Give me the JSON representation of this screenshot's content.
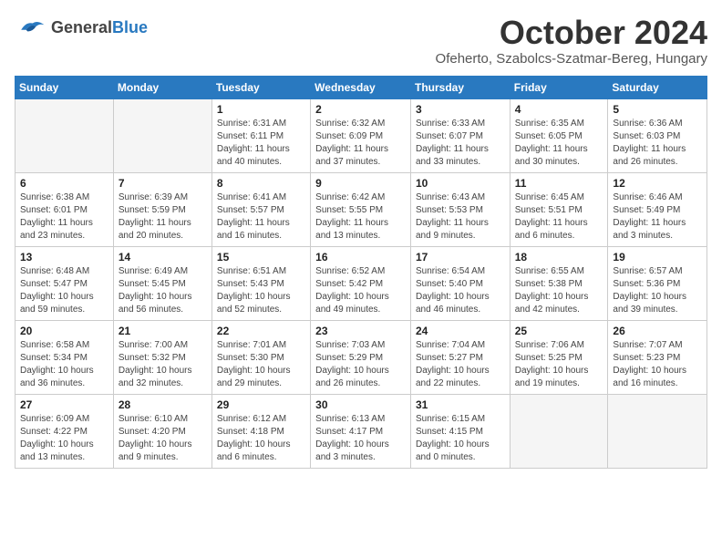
{
  "logo": {
    "line1": "General",
    "line2": "Blue"
  },
  "title": "October 2024",
  "location": "Ofeherto, Szabolcs-Szatmar-Bereg, Hungary",
  "weekdays": [
    "Sunday",
    "Monday",
    "Tuesday",
    "Wednesday",
    "Thursday",
    "Friday",
    "Saturday"
  ],
  "weeks": [
    [
      {
        "day": "",
        "detail": ""
      },
      {
        "day": "",
        "detail": ""
      },
      {
        "day": "1",
        "detail": "Sunrise: 6:31 AM\nSunset: 6:11 PM\nDaylight: 11 hours and 40 minutes."
      },
      {
        "day": "2",
        "detail": "Sunrise: 6:32 AM\nSunset: 6:09 PM\nDaylight: 11 hours and 37 minutes."
      },
      {
        "day": "3",
        "detail": "Sunrise: 6:33 AM\nSunset: 6:07 PM\nDaylight: 11 hours and 33 minutes."
      },
      {
        "day": "4",
        "detail": "Sunrise: 6:35 AM\nSunset: 6:05 PM\nDaylight: 11 hours and 30 minutes."
      },
      {
        "day": "5",
        "detail": "Sunrise: 6:36 AM\nSunset: 6:03 PM\nDaylight: 11 hours and 26 minutes."
      }
    ],
    [
      {
        "day": "6",
        "detail": "Sunrise: 6:38 AM\nSunset: 6:01 PM\nDaylight: 11 hours and 23 minutes."
      },
      {
        "day": "7",
        "detail": "Sunrise: 6:39 AM\nSunset: 5:59 PM\nDaylight: 11 hours and 20 minutes."
      },
      {
        "day": "8",
        "detail": "Sunrise: 6:41 AM\nSunset: 5:57 PM\nDaylight: 11 hours and 16 minutes."
      },
      {
        "day": "9",
        "detail": "Sunrise: 6:42 AM\nSunset: 5:55 PM\nDaylight: 11 hours and 13 minutes."
      },
      {
        "day": "10",
        "detail": "Sunrise: 6:43 AM\nSunset: 5:53 PM\nDaylight: 11 hours and 9 minutes."
      },
      {
        "day": "11",
        "detail": "Sunrise: 6:45 AM\nSunset: 5:51 PM\nDaylight: 11 hours and 6 minutes."
      },
      {
        "day": "12",
        "detail": "Sunrise: 6:46 AM\nSunset: 5:49 PM\nDaylight: 11 hours and 3 minutes."
      }
    ],
    [
      {
        "day": "13",
        "detail": "Sunrise: 6:48 AM\nSunset: 5:47 PM\nDaylight: 10 hours and 59 minutes."
      },
      {
        "day": "14",
        "detail": "Sunrise: 6:49 AM\nSunset: 5:45 PM\nDaylight: 10 hours and 56 minutes."
      },
      {
        "day": "15",
        "detail": "Sunrise: 6:51 AM\nSunset: 5:43 PM\nDaylight: 10 hours and 52 minutes."
      },
      {
        "day": "16",
        "detail": "Sunrise: 6:52 AM\nSunset: 5:42 PM\nDaylight: 10 hours and 49 minutes."
      },
      {
        "day": "17",
        "detail": "Sunrise: 6:54 AM\nSunset: 5:40 PM\nDaylight: 10 hours and 46 minutes."
      },
      {
        "day": "18",
        "detail": "Sunrise: 6:55 AM\nSunset: 5:38 PM\nDaylight: 10 hours and 42 minutes."
      },
      {
        "day": "19",
        "detail": "Sunrise: 6:57 AM\nSunset: 5:36 PM\nDaylight: 10 hours and 39 minutes."
      }
    ],
    [
      {
        "day": "20",
        "detail": "Sunrise: 6:58 AM\nSunset: 5:34 PM\nDaylight: 10 hours and 36 minutes."
      },
      {
        "day": "21",
        "detail": "Sunrise: 7:00 AM\nSunset: 5:32 PM\nDaylight: 10 hours and 32 minutes."
      },
      {
        "day": "22",
        "detail": "Sunrise: 7:01 AM\nSunset: 5:30 PM\nDaylight: 10 hours and 29 minutes."
      },
      {
        "day": "23",
        "detail": "Sunrise: 7:03 AM\nSunset: 5:29 PM\nDaylight: 10 hours and 26 minutes."
      },
      {
        "day": "24",
        "detail": "Sunrise: 7:04 AM\nSunset: 5:27 PM\nDaylight: 10 hours and 22 minutes."
      },
      {
        "day": "25",
        "detail": "Sunrise: 7:06 AM\nSunset: 5:25 PM\nDaylight: 10 hours and 19 minutes."
      },
      {
        "day": "26",
        "detail": "Sunrise: 7:07 AM\nSunset: 5:23 PM\nDaylight: 10 hours and 16 minutes."
      }
    ],
    [
      {
        "day": "27",
        "detail": "Sunrise: 6:09 AM\nSunset: 4:22 PM\nDaylight: 10 hours and 13 minutes."
      },
      {
        "day": "28",
        "detail": "Sunrise: 6:10 AM\nSunset: 4:20 PM\nDaylight: 10 hours and 9 minutes."
      },
      {
        "day": "29",
        "detail": "Sunrise: 6:12 AM\nSunset: 4:18 PM\nDaylight: 10 hours and 6 minutes."
      },
      {
        "day": "30",
        "detail": "Sunrise: 6:13 AM\nSunset: 4:17 PM\nDaylight: 10 hours and 3 minutes."
      },
      {
        "day": "31",
        "detail": "Sunrise: 6:15 AM\nSunset: 4:15 PM\nDaylight: 10 hours and 0 minutes."
      },
      {
        "day": "",
        "detail": ""
      },
      {
        "day": "",
        "detail": ""
      }
    ]
  ]
}
